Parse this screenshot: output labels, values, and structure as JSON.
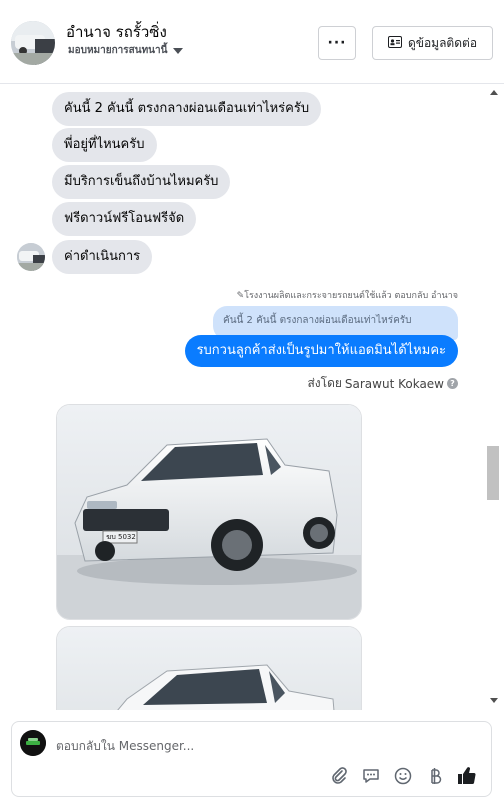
{
  "header": {
    "contact_name": "อำนาจ รถรั้วซิ่ง",
    "contact_subtitle": "มอบหมายการสนทนานี้",
    "more_label": "···",
    "info_button_label": "ดูข้อมูลติดต่อ"
  },
  "messages": {
    "incoming": [
      "คันนี้ 2 คันนี้ ตรงกลางผ่อนเดือนเท่าไหร่ครับ",
      "พี่อยู่ที่ไหนครับ",
      "มีบริการเข็นถึงบ้านไหมครับ",
      "ฟรีดาวน์ฟรีโอนฟรีจัด",
      "ค่าดำเนินการ"
    ],
    "reply_note": "✎โรงงานผลิตและกระจายรถยนต์ใช้แล้ว ตอบกลับ อำนาจ",
    "quoted_text": "คันนี้ 2 คันนี้ ตรงกลางผ่อนเดือนเท่าไหร่ครับ",
    "outgoing_text": "รบกวนลูกค้าส่งเป็นรูปมาให้แอดมินได้ไหมคะ",
    "sent_by_prefix": "ส่งโดย",
    "sent_by_name": "Sarawut Kokaew",
    "help_symbol": "?",
    "plate_text": "ฆบ 5032"
  },
  "composer": {
    "placeholder": "ตอบกลับใน Messenger...",
    "icons": [
      "paperclip-icon",
      "chat-bubble-icon",
      "smiley-icon",
      "baht-icon",
      "thumbs-up-icon"
    ]
  },
  "colors": {
    "outgoing_bubble": "#0a7cff",
    "incoming_bubble": "#e4e6eb",
    "quoted_bubble": "#cfe2fb",
    "like_icon": "#1c1e21"
  }
}
